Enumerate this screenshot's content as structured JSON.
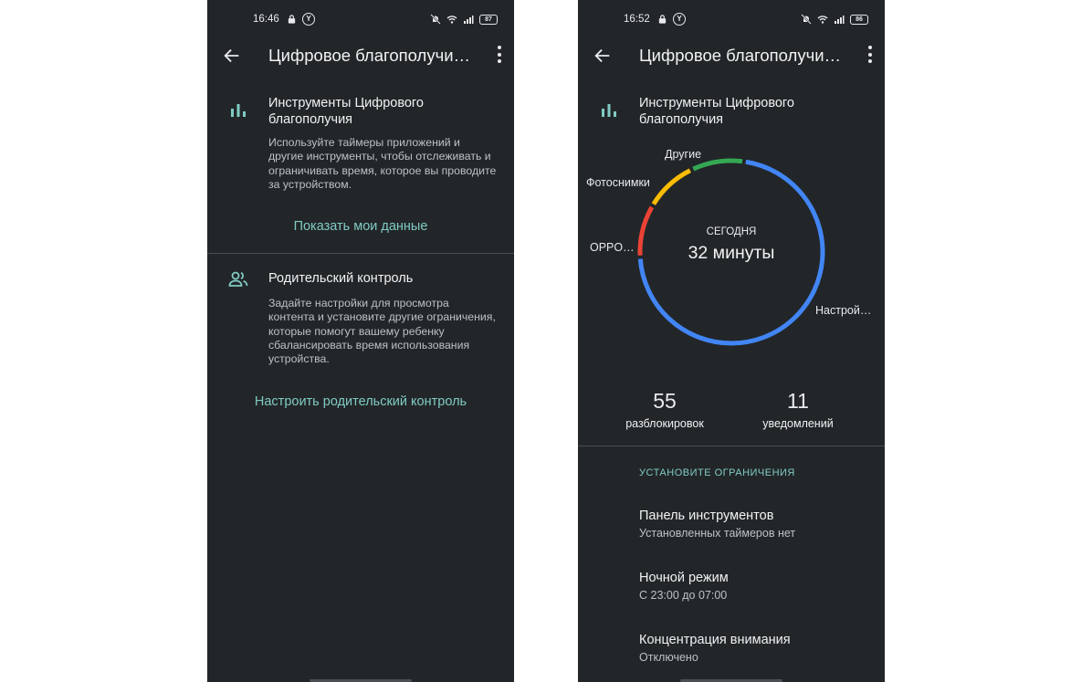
{
  "left": {
    "status": {
      "time": "16:46",
      "battery": "87"
    },
    "appbar": {
      "title": "Цифровое благополучи…"
    },
    "tools": {
      "title": "Инструменты Цифрового благополучия",
      "desc": "Используйте таймеры приложений и другие инструменты, чтобы отслеживать и ограничивать время, которое вы проводите за устройством.",
      "link": "Показать мои данные"
    },
    "parental": {
      "title": "Родительский контроль",
      "desc": "Задайте настройки для просмотра контента и установите другие ограничения, которые помогут вашему ребенку сбалансировать время использования устройства.",
      "link": "Настроить родительский контроль"
    }
  },
  "right": {
    "status": {
      "time": "16:52",
      "battery": "86"
    },
    "appbar": {
      "title": "Цифровое благополучи…"
    },
    "tools": {
      "title": "Инструменты Цифрового благополучия"
    },
    "usage": {
      "caption": "СЕГОДНЯ",
      "total": "32 минуты"
    },
    "stats": {
      "unlocks_value": "55",
      "unlocks_label": "разблокировок",
      "notifications_value": "11",
      "notifications_label": "уведомлений"
    },
    "limits": {
      "header": "УСТАНОВИТЕ ОГРАНИЧЕНИЯ",
      "items": [
        {
          "title": "Панель инструментов",
          "subtitle": "Установленных таймеров нет"
        },
        {
          "title": "Ночной режим",
          "subtitle": "С 23:00 до 07:00"
        },
        {
          "title": "Концентрация внимания",
          "subtitle": "Отключено"
        }
      ]
    }
  },
  "icons": {
    "back": "arrow-left-icon",
    "more": "more-vert-icon",
    "bar_chart": "bar-chart-icon",
    "people": "supervisor-icon",
    "lock": "lock-icon",
    "wifi": "wifi-icon"
  },
  "colors": {
    "accent": "#80cbc4",
    "background": "#222629"
  },
  "chart_data": {
    "type": "pie",
    "title": "",
    "unit": "min",
    "categories": [
      "Настрой…",
      "OPPO…",
      "Фотоснимки",
      "Другие"
    ],
    "values": [
      23,
      3,
      3,
      3
    ],
    "colors": [
      "#4285f4",
      "#ea4335",
      "#fbbc04",
      "#34a853"
    ]
  }
}
